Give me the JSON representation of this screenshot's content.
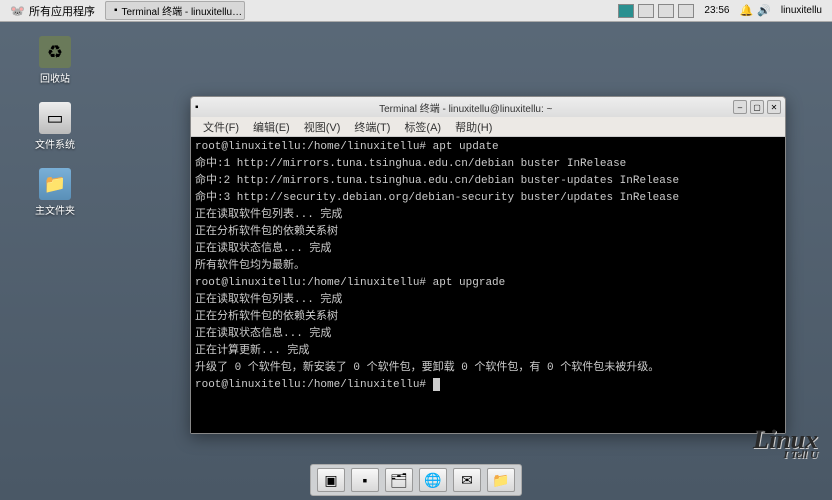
{
  "panel": {
    "apps_menu": "所有应用程序",
    "taskbar_item": "Terminal 终端 - linuxitellu…",
    "clock": "23:56",
    "user": "linuxitellu"
  },
  "desktop": {
    "trash": "回收站",
    "filesystem": "文件系统",
    "home": "主文件夹"
  },
  "terminal": {
    "title": "Terminal 终端 - linuxitellu@linuxitellu: ~",
    "menus": {
      "file": "文件(F)",
      "edit": "编辑(E)",
      "view": "视图(V)",
      "terminal": "终端(T)",
      "tabs": "标签(A)",
      "help": "帮助(H)"
    },
    "lines": [
      "root@linuxitellu:/home/linuxitellu# apt update",
      "命中:1 http://mirrors.tuna.tsinghua.edu.cn/debian buster InRelease",
      "命中:2 http://mirrors.tuna.tsinghua.edu.cn/debian buster-updates InRelease",
      "命中:3 http://security.debian.org/debian-security buster/updates InRelease",
      "正在读取软件包列表... 完成",
      "正在分析软件包的依赖关系树",
      "正在读取状态信息... 完成",
      "所有软件包均为最新。",
      "root@linuxitellu:/home/linuxitellu# apt upgrade",
      "正在读取软件包列表... 完成",
      "正在分析软件包的依赖关系树",
      "正在读取状态信息... 完成",
      "正在计算更新... 完成",
      "升级了 0 个软件包，新安装了 0 个软件包，要卸载 0 个软件包，有 0 个软件包未被升级。",
      "root@linuxitellu:/home/linuxitellu# "
    ]
  },
  "logo": {
    "main": "Linux",
    "sub": "I Tell U"
  },
  "dock": {
    "items": [
      "window-icon",
      "terminal-icon",
      "files-icon",
      "web-icon",
      "mail-icon",
      "folder-icon"
    ]
  }
}
